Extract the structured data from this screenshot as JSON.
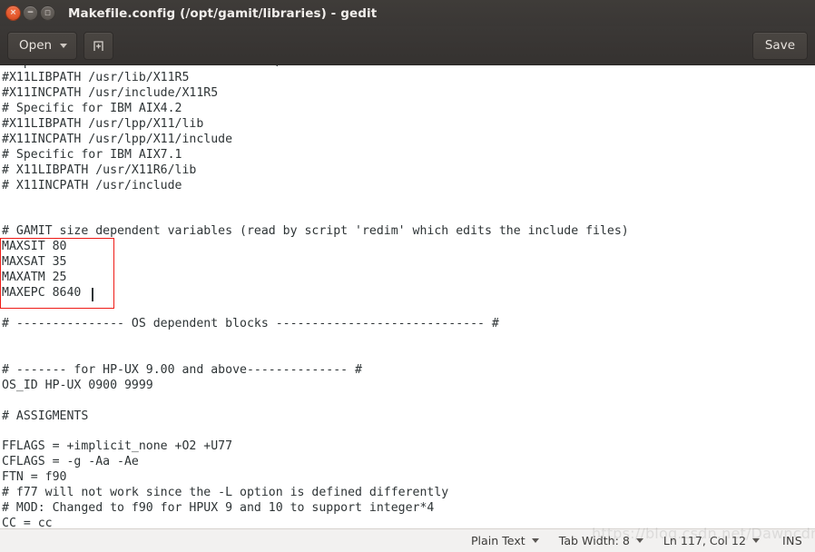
{
  "window": {
    "title": "Makefile.config (/opt/gamit/libraries) - gedit",
    "controls": {
      "close": "×",
      "minimize": "−",
      "maximize": "□"
    }
  },
  "toolbar": {
    "open_label": "Open",
    "new_document_icon": "new-document-icon",
    "save_label": "Save"
  },
  "editor": {
    "lines": [
      "# Specific for HP-UX and Sun for Motif/X",
      "#X11LIBPATH /usr/lib/X11R5",
      "#X11INCPATH /usr/include/X11R5",
      "# Specific for IBM AIX4.2",
      "#X11LIBPATH /usr/lpp/X11/lib",
      "#X11INCPATH /usr/lpp/X11/include",
      "# Specific for IBM AIX7.1",
      "# X11LIBPATH /usr/X11R6/lib",
      "# X11INCPATH /usr/include",
      "",
      "",
      "# GAMIT size dependent variables (read by script 'redim' which edits the include files)",
      "MAXSIT 80",
      "MAXSAT 35",
      "MAXATM 25",
      "MAXEPC 8640",
      "",
      "# --------------- OS dependent blocks ----------------------------- #",
      "",
      "",
      "# ------- for HP-UX 9.00 and above-------------- #",
      "OS_ID HP-UX 0900 9999",
      "",
      "# ASSIGMENTS",
      "",
      "FFLAGS = +implicit_none +O2 +U77",
      "CFLAGS = -g -Aa -Ae",
      "FTN = f90",
      "# f77 will not work since the -L option is defined differently",
      "# MOD: Changed to f90 for HPUX 9 and 10 to support integer*4",
      "CC = cc"
    ],
    "annotation_color": "#ee1b16",
    "cursor_after": "MAXEPC 8640"
  },
  "statusbar": {
    "language": "Plain Text",
    "tab_width": "Tab Width: 8",
    "position": "Ln 117, Col 12",
    "insert_mode": "INS"
  },
  "watermark": {
    "text": "https://blog.csdn.net/Dawncdm"
  }
}
